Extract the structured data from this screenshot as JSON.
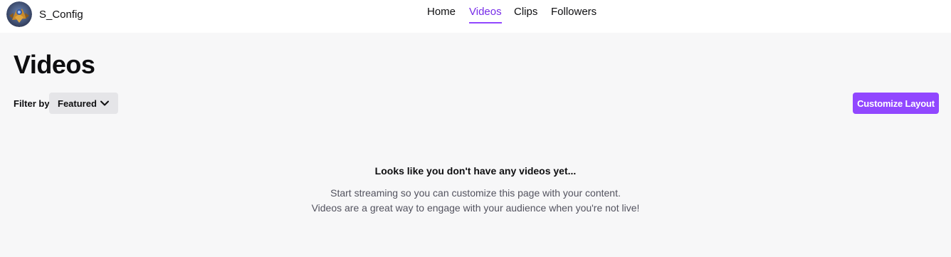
{
  "header": {
    "channel_name": "S_Config",
    "tabs": [
      {
        "label": "Home",
        "active": false
      },
      {
        "label": "Videos",
        "active": true
      },
      {
        "label": "Clips",
        "active": false
      },
      {
        "label": "Followers",
        "active": false
      }
    ]
  },
  "main": {
    "title": "Videos",
    "filter_label": "Filter by",
    "filter_value": "Featured",
    "customize_button": "Customize Layout",
    "empty_heading": "Looks like you don't have any videos yet...",
    "empty_line_1": "Start streaming so you can customize this page with your content.",
    "empty_line_2": "Videos are a great way to engage with your audience when you're not live!"
  },
  "colors": {
    "accent": "#9147ff",
    "accent_text": "#772ce8",
    "background": "#f7f7f8",
    "header_bg": "#ffffff"
  },
  "icons": {
    "avatar": "profile-avatar",
    "dropdown": "chevron-down-icon"
  }
}
